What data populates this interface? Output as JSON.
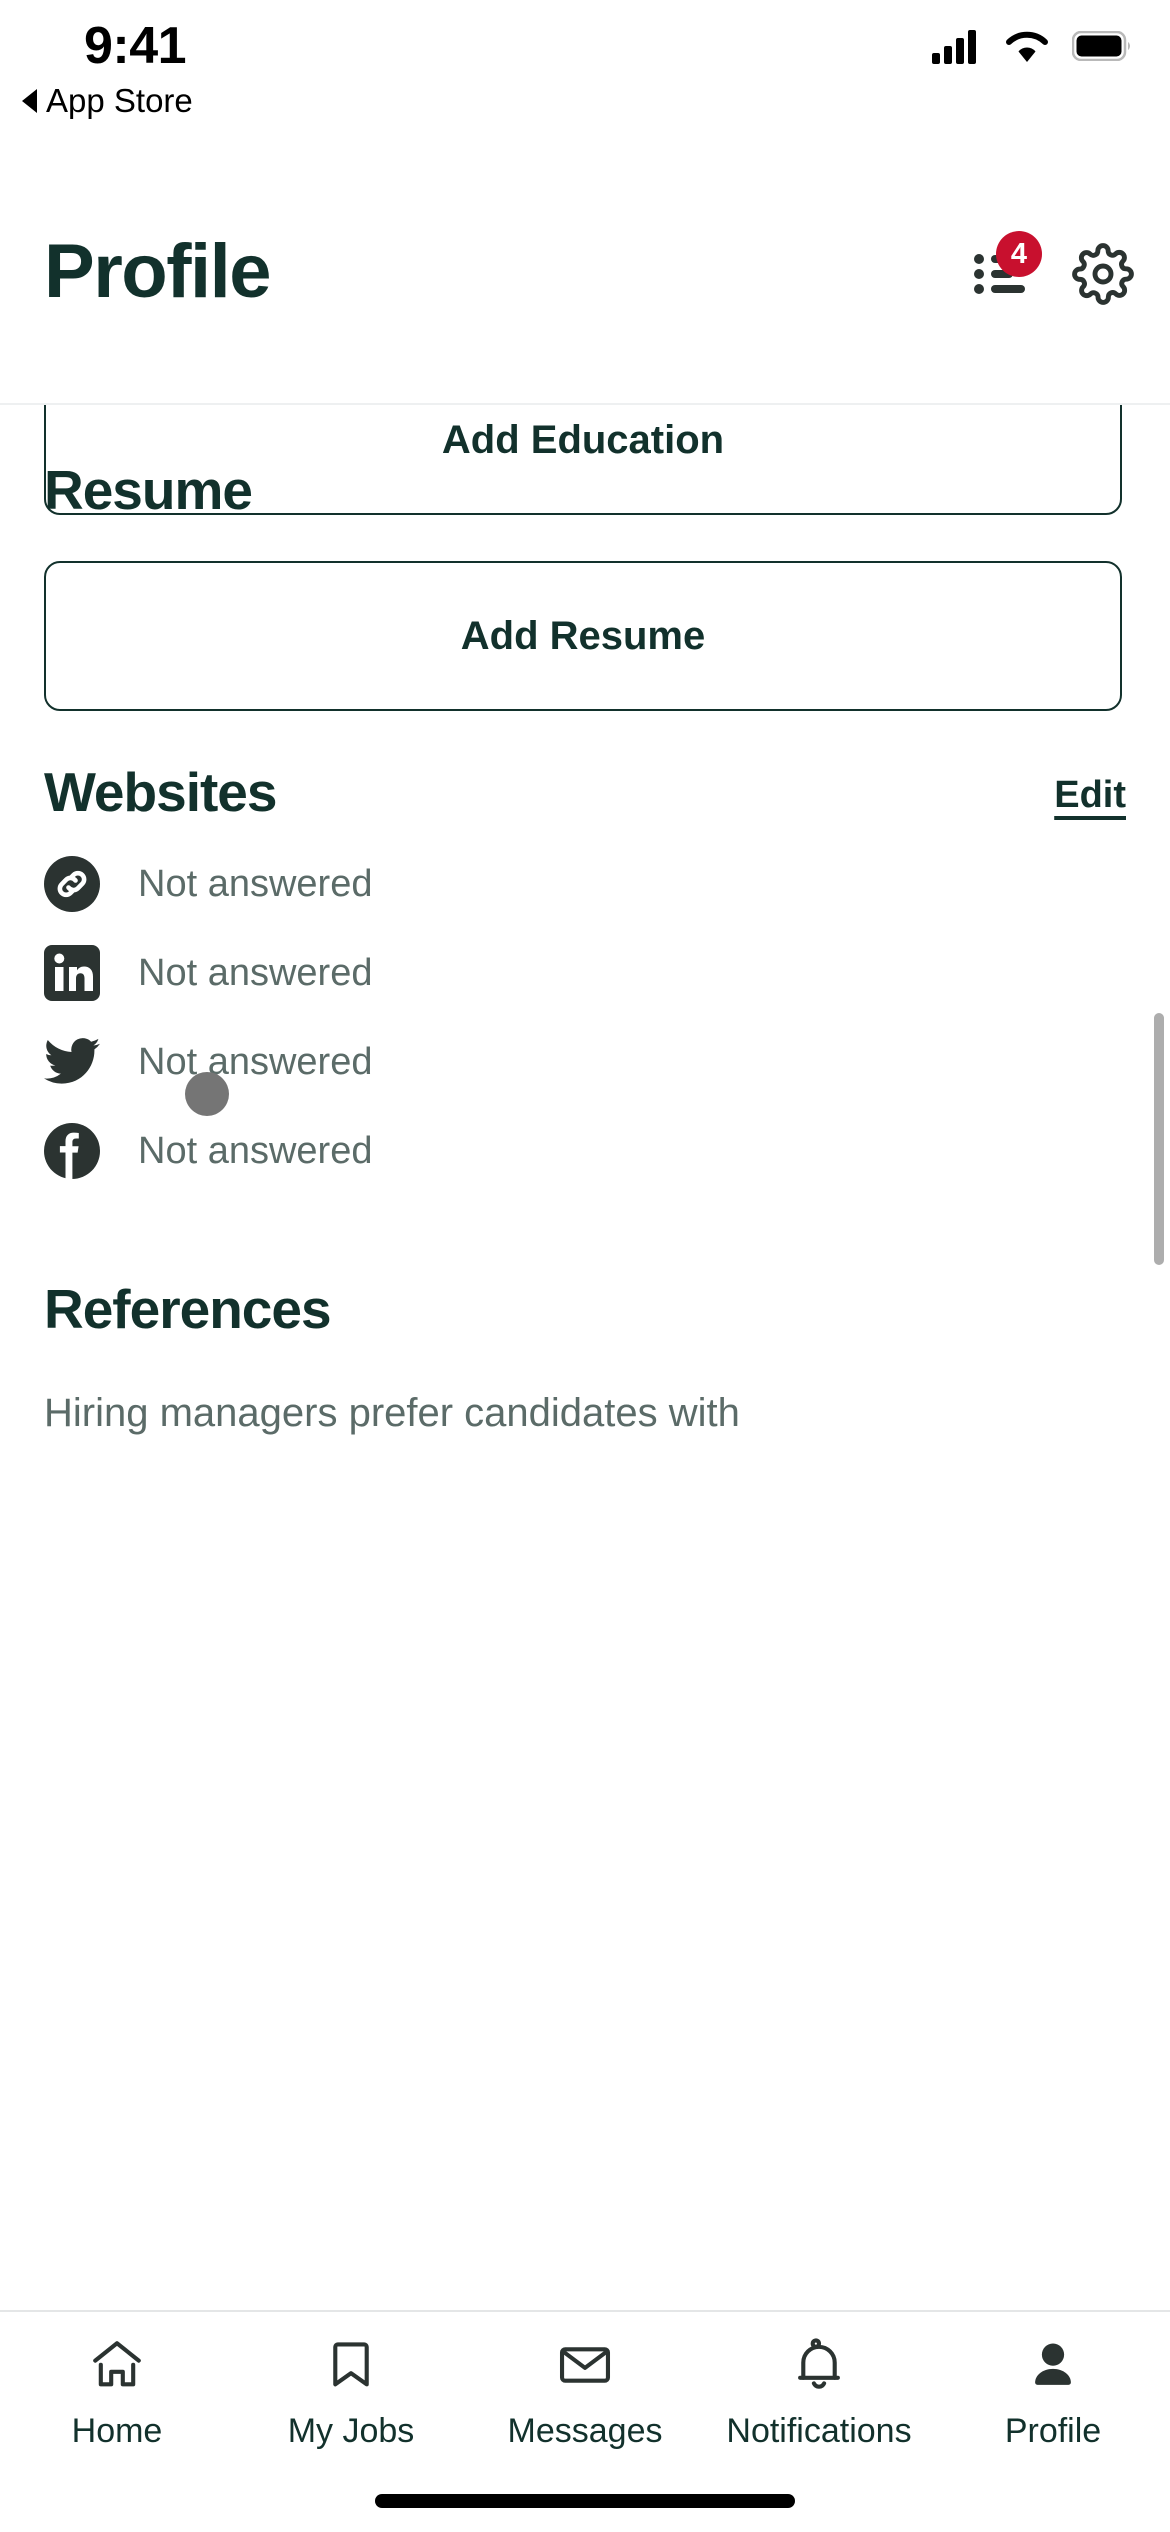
{
  "status_bar": {
    "time": "9:41",
    "back_label": "App Store",
    "back_icon": "triangle-left-icon",
    "cellular_icon": "cellular-signal-icon",
    "wifi_icon": "wifi-icon",
    "battery_icon": "battery-full-icon"
  },
  "header": {
    "title": "Profile",
    "checklist_icon": "checklist-icon",
    "checklist_badge_count": "4",
    "settings_icon": "gear-icon",
    "badge_color": "#c8102e",
    "title_color": "#12312c"
  },
  "content": {
    "add_education_label": "Add Education",
    "resume_section_title": "Resume",
    "add_resume_label": "Add Resume",
    "websites_section_title": "Websites",
    "websites_edit_label": "Edit",
    "websites": [
      {
        "icon": "link-icon",
        "value": "Not answered"
      },
      {
        "icon": "linkedin-icon",
        "value": "Not answered"
      },
      {
        "icon": "twitter-icon",
        "value": "Not answered"
      },
      {
        "icon": "facebook-icon",
        "value": "Not answered"
      }
    ],
    "references_section_title": "References",
    "references_description": "Hiring managers prefer candidates with"
  },
  "tab_bar": {
    "items": [
      {
        "label": "Home",
        "icon": "home-icon",
        "active": false
      },
      {
        "label": "My Jobs",
        "icon": "bookmark-icon",
        "active": false
      },
      {
        "label": "Messages",
        "icon": "envelope-icon",
        "active": false
      },
      {
        "label": "Notifications",
        "icon": "bell-icon",
        "active": false
      },
      {
        "label": "Profile",
        "icon": "person-icon",
        "active": true
      }
    ]
  }
}
